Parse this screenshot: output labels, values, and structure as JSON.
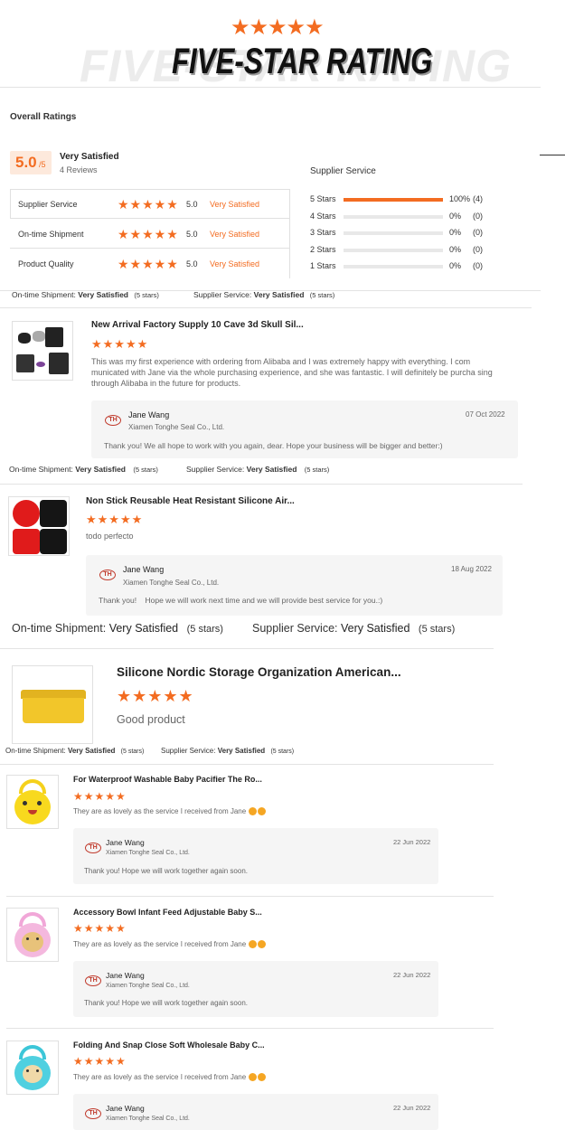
{
  "banner": {
    "title": "FIVE-STAR RATING",
    "watermark": "FIVE-STAR RATING",
    "stars": "★★★★★"
  },
  "overall": {
    "heading": "Overall Ratings",
    "score": "5.0",
    "score_suffix": "/5",
    "satisfaction": "Very Satisfied",
    "reviews": "4 Reviews",
    "rows": [
      {
        "label": "Supplier Service",
        "stars": "★★★★★",
        "score": "5.0",
        "level": "Very Satisfied"
      },
      {
        "label": "On-time Shipment",
        "stars": "★★★★★",
        "score": "5.0",
        "level": "Very Satisfied"
      },
      {
        "label": "Product Quality",
        "stars": "★★★★★",
        "score": "5.0",
        "level": "Very Satisfied"
      }
    ],
    "breakdown_title": "Supplier Service",
    "breakdown": [
      {
        "label": "5 Stars",
        "fill": 1.0,
        "pct": "100%",
        "count": "(4)"
      },
      {
        "label": "4 Stars",
        "fill": 0,
        "pct": "0%",
        "count": "(0)"
      },
      {
        "label": "3 Stars",
        "fill": 0,
        "pct": "0%",
        "count": "(0)"
      },
      {
        "label": "2 Stars",
        "fill": 0,
        "pct": "0%",
        "count": "(0)"
      },
      {
        "label": "1 Stars",
        "fill": 0,
        "pct": "0%",
        "count": "(0)"
      }
    ],
    "footer": {
      "ship_label": "On-time Shipment:",
      "ship_value": "Very Satisfied",
      "ship_stars": "(5 stars)",
      "svc_label": "Supplier Service:",
      "svc_value": "Very Satisfied",
      "svc_stars": "(5 stars)"
    }
  },
  "reviews": [
    {
      "title": "New Arrival Factory Supply 10 Cave 3d Skull Sil...",
      "stars": "★★★★★",
      "text": "This was my first experience with ordering from Alibaba and I was extremely happy with everything. I com municated with Jane via the whole purchasing experience, and she was fantastic. I will definitely be purcha sing through Alibaba in the future for products.",
      "reply_name": "Jane Wang",
      "reply_company": "Xiamen Tonghe Seal Co., Ltd.",
      "reply_date": "07 Oct 2022",
      "reply_text": "Thank you! We all hope to work with you again, dear. Hope your business will be bigger and better:)",
      "ship_label": "On-time Shipment:",
      "ship_value": "Very Satisfied",
      "ship_stars": "(5 stars)",
      "svc_label": "Supplier Service:",
      "svc_value": "Very Satisfied",
      "svc_stars": "(5 stars)"
    },
    {
      "title": "Non Stick Reusable Heat Resistant Silicone Air...",
      "stars": "★★★★★",
      "text": "todo perfecto",
      "reply_name": "Jane Wang",
      "reply_company": "Xiamen Tonghe Seal Co., Ltd.",
      "reply_date": "18 Aug 2022",
      "reply_text": "Thank you!    Hope we will work next time and we will provide best service for you.:)",
      "ship_label": "On-time Shipment:",
      "ship_value": "Very Satisfied",
      "ship_stars": "(5 stars)",
      "svc_label": "Supplier Service:",
      "svc_value": "Very Satisfied",
      "svc_stars": "(5 stars)"
    },
    {
      "title": "Silicone Nordic Storage Organization American...",
      "stars": "★★★★★",
      "text": "Good product",
      "ship_label": "On-time Shipment:",
      "ship_value": "Very Satisfied",
      "ship_stars": "(5 stars)",
      "svc_label": "Supplier Service:",
      "svc_value": "Very Satisfied",
      "svc_stars": "(5 stars)"
    },
    {
      "title": "For Waterproof Washable Baby Pacifier The Ro...",
      "stars": "★★★★★",
      "text": "They are as lovely as the service I received from Jane",
      "reply_name": "Jane Wang",
      "reply_company": "Xiamen Tonghe Seal Co., Ltd.",
      "reply_date": "22 Jun 2022",
      "reply_text": "Thank you! Hope we will work together again soon."
    },
    {
      "title": "Accessory Bowl Infant Feed Adjustable Baby S...",
      "stars": "★★★★★",
      "text": "They are as lovely as the service I received from Jane",
      "reply_name": "Jane Wang",
      "reply_company": "Xiamen Tonghe Seal Co., Ltd.",
      "reply_date": "22 Jun 2022",
      "reply_text": "Thank you! Hope we will work together again soon."
    },
    {
      "title": "Folding And Snap Close Soft Wholesale Baby C...",
      "stars": "★★★★★",
      "text": "They are as lovely as the service I received from Jane",
      "reply_name": "Jane Wang",
      "reply_company": "Xiamen Tonghe Seal Co., Ltd.",
      "reply_date": "22 Jun 2022"
    }
  ]
}
